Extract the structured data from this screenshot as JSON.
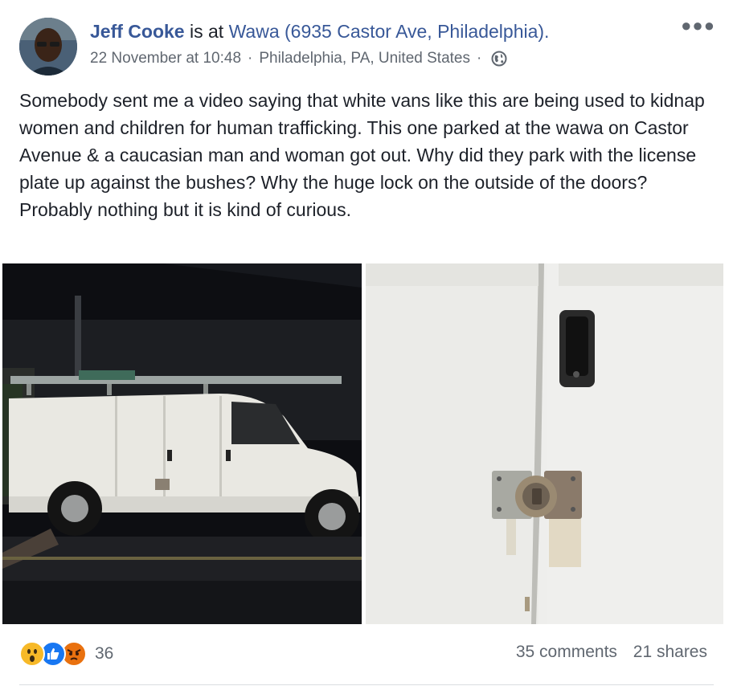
{
  "post": {
    "author": "Jeff Cooke",
    "is_at_text": " is at ",
    "place": "Wawa (6935 Castor Ave, Philadelphia).",
    "timestamp": "22 November at 10:48",
    "separator": "·",
    "location": "Philadelphia, PA, United States",
    "separator2": "·",
    "audience_icon": "globe-icon",
    "more_icon": "more-options-icon",
    "text": "Somebody sent me a video saying that white vans like this are being used to kidnap women and children for human trafficking. This one parked at the wawa on Castor Avenue & a caucasian man and woman got out. Why did they park with the license plate up against the bushes? Why the huge lock on the outside of the doors? Probably nothing but it is kind of curious."
  },
  "photos": [
    {
      "name": "white-van-night-photo"
    },
    {
      "name": "van-door-lock-photo"
    }
  ],
  "footer": {
    "reactions": [
      "wow",
      "like",
      "angry"
    ],
    "reaction_count": "36",
    "comments": "35 comments",
    "shares": "21 shares"
  },
  "colors": {
    "link": "#385898",
    "meta": "#606770",
    "like": "#1877f2",
    "wow": "#f7b928",
    "angry": "#e9710f"
  }
}
